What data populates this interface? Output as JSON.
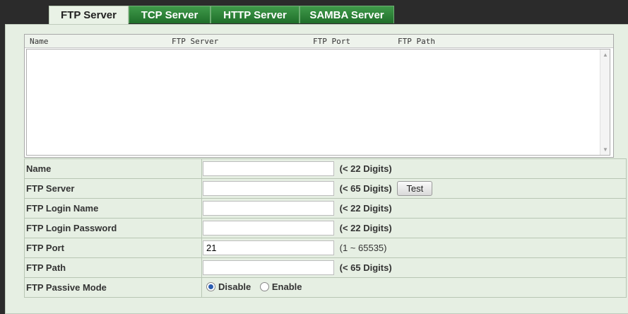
{
  "tabs": [
    {
      "label": "FTP Server",
      "active": true
    },
    {
      "label": "TCP Server",
      "active": false
    },
    {
      "label": "HTTP Server",
      "active": false
    },
    {
      "label": "SAMBA Server",
      "active": false
    }
  ],
  "list": {
    "columns": [
      "Name",
      "FTP Server",
      "FTP Port",
      "FTP Path"
    ]
  },
  "form": {
    "name": {
      "label": "Name",
      "value": "",
      "hint": "(< 22 Digits)"
    },
    "server": {
      "label": "FTP Server",
      "value": "",
      "hint": "(< 65 Digits)",
      "test_label": "Test"
    },
    "login": {
      "label": "FTP Login Name",
      "value": "",
      "hint": "(< 22 Digits)"
    },
    "password": {
      "label": "FTP Login Password",
      "value": "",
      "hint": "(< 22 Digits)"
    },
    "port": {
      "label": "FTP Port",
      "value": "21",
      "hint": "(1 ~ 65535)"
    },
    "path": {
      "label": "FTP Path",
      "value": "",
      "hint": "(< 65 Digits)"
    },
    "passive": {
      "label": "FTP Passive Mode",
      "options": [
        "Disable",
        "Enable"
      ],
      "selected": "Disable"
    }
  }
}
